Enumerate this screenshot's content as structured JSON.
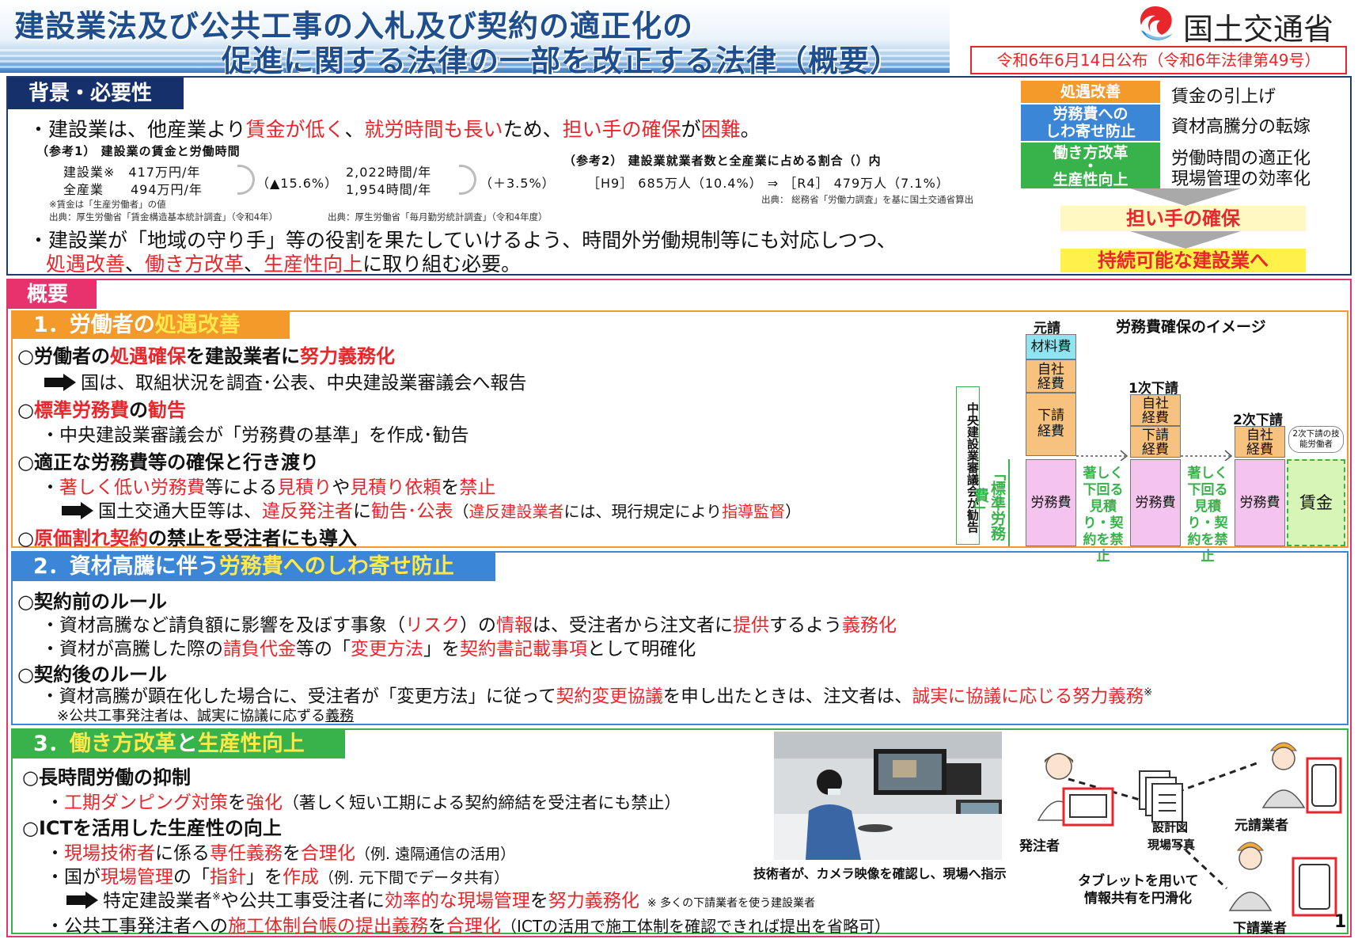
{
  "header": {
    "title_line1": "建設業法及び公共工事の入札及び契約の適正化の",
    "title_line2": "促進に関する法律の一部を改正する法律（概要）",
    "ministry": "国土交通省",
    "promulgation": "令和6年6月14日公布（令和6年法律第49号）"
  },
  "background": {
    "label": "背景・必要性",
    "bullet1": {
      "a": "・建設業は、他産業より",
      "b": "賃金が低く",
      "c": "、",
      "d": "就労時間も長い",
      "e": "ため、",
      "f": "担い手の確保",
      "g": "が",
      "h": "困難",
      "i": "。"
    },
    "ref1": {
      "title": "（参考1） 建設業の賃金と労働時間",
      "row1": "建設業※　417万円/年",
      "row2": "全産業　　494万円/年",
      "change1": "（▲15.6%）",
      "hours1": "2,022時間/年",
      "hours2": "1,954時間/年",
      "change2": "（＋3.5%）",
      "note": "※賃金は「生産労働者」の値",
      "source1": "出典：厚生労働省「賃金構造基本統計調査」（令和4年）",
      "source2": "出典：厚生労働省「毎月勤労統計調査」（令和4年度）"
    },
    "ref2": {
      "title": "（参考2） 建設業就業者数と全産業に占める割合（）内",
      "data": "［H9］ 685万人（10.4%） ⇒ ［R4］ 479万人（7.1%）",
      "source": "出典： 総務省「労働力調査」を基に国土交通省算出"
    },
    "bullet2": {
      "a": "・建設業が「地域の守り手」等の役割を果たしていけるよう、時間外労働規制等にも対応しつつ、",
      "b": "処遇改善",
      "c": "、",
      "d": "働き方改革",
      "e": "、",
      "f": "生産性向上",
      "g": "に取り組む必要。"
    },
    "summary": {
      "tag_treat": "処遇改善",
      "desc_treat": "賃金の引上げ",
      "tag_labor1": "労務費への",
      "tag_labor2": "しわ寄せ防止",
      "desc_labor": "資材高騰分の転嫁",
      "tag_work1": "働き方改革",
      "tag_work_dot": "・",
      "tag_work2": "生産性向上",
      "desc_work1": "労働時間の適正化",
      "desc_work2": "現場管理の効率化",
      "result1": "担い手の確保",
      "result2": "持続可能な建設業へ"
    }
  },
  "overview": {
    "label": "概要",
    "s1": {
      "label_num": "1．労働者の",
      "label_hl": "処遇改善",
      "h1": {
        "a": "○労働者の",
        "b": "処遇確保",
        "c": "を建設業者に",
        "d": "努力義務化"
      },
      "l1": "国は、取組状況を調査･公表、中央建設業審議会へ報告",
      "h2": {
        "a": "○",
        "b": "標準労務費",
        "c": "の",
        "d": "勧告"
      },
      "l2": "・中央建設業審議会が「労務費の基準」を作成･勧告",
      "h3": "○適正な労務費等の確保と行き渡り",
      "l3": {
        "a": "・",
        "b": "著しく低い労務費",
        "c": "等による",
        "d": "見積り",
        "e": "や",
        "f": "見積り依頼",
        "g": "を",
        "h": "禁止"
      },
      "l4": {
        "a": "国土交通大臣等は、",
        "b": "違反発注者",
        "c": "に",
        "d": "勧告･公表",
        "e": "（",
        "f": "違反建設業者",
        "g": "には、現行規定により",
        "h": "指導監督",
        "i": "）"
      },
      "h4": {
        "a": "○",
        "b": "原価割れ契約",
        "c": "の禁止を受注者にも導入"
      },
      "diagram": {
        "title": "労務費確保のイメージ",
        "prime": "元請",
        "sub1": "1次下請",
        "sub2": "2次下請",
        "material": "材料費",
        "own_cost": "自社経費",
        "sub_cost": "下請経費",
        "labor": "労務費",
        "wage": "賃金",
        "sub2_worker": "2次下請の技能労働者",
        "council": "中央建設業審議会が勧告",
        "standard": "「標準労務費」",
        "prohibit": "著しく下回る見積り・契約を禁止"
      }
    },
    "s2": {
      "label_num": "2．資材高騰に伴う",
      "label_hl": "労務費へのしわ寄せ防止",
      "h1": "○契約前のルール",
      "l1": {
        "a": "・資材高騰など請負額に影響を及ぼす事象（",
        "b": "リスク",
        "c": "）の",
        "d": "情報",
        "e": "は、受注者から注文者に",
        "f": "提供",
        "g": "するよう",
        "h": "義務化"
      },
      "l2": {
        "a": "・資材が高騰した際の",
        "b": "請負代金",
        "c": "等の「",
        "d": "変更方法",
        "e": "」を",
        "f": "契約書記載事項",
        "g": "として明確化"
      },
      "h2": "○契約後のルール",
      "l3": {
        "a": "・資材高騰が顕在化した場合に、受注者が「変更方法」に従って",
        "b": "契約変更協議",
        "c": "を申し出たときは、注文者は、",
        "d": "誠実に協議に応じる努力義務",
        "e": "※"
      },
      "note": {
        "a": "※公共工事発注者は、誠実に協議に応ずる",
        "b": "義務"
      }
    },
    "s3": {
      "label_num": "3．",
      "label_hl1": "働き方改革",
      "label_mid": "と",
      "label_hl2": "生産性向上",
      "h1": "○長時間労働の抑制",
      "l1": {
        "a": "・",
        "b": "工期ダンピング対策",
        "c": "を",
        "d": "強化",
        "e": "（著しく短い工期による契約締結を受注者にも禁止）"
      },
      "h2": "○ICTを活用した生産性の向上",
      "l2": {
        "a": "・",
        "b": "現場技術者",
        "c": "に係る",
        "d": "専任義務",
        "e": "を",
        "f": "合理化",
        "g": "（例. 遠隔通信の活用）"
      },
      "l3": {
        "a": "・国が",
        "b": "現場管理",
        "c": "の「",
        "d": "指針",
        "e": "」を",
        "f": "作成",
        "g": "（例. 元下間でデータ共有）"
      },
      "l4": {
        "a": "特定建設業者",
        "b": "※",
        "c": "や公共工事受注者に",
        "d": "効率的な現場管理",
        "e": "を",
        "f": "努力義務化",
        "g": "※ 多くの下請業者を使う建設業者"
      },
      "l5": {
        "a": "・公共工事発注者への",
        "b": "施工体制台帳の提出義務",
        "c": "を",
        "d": "合理化",
        "e": "（ICTの活用で施工体制を確認できれば提出を省略可）"
      },
      "photo_caption": "技術者が、カメラ映像を確認し、現場へ指示",
      "orderer": "発注者",
      "docs1": "設計図",
      "docs2": "現場写真",
      "prime_contractor": "元請業者",
      "sub_contractor": "下請業者",
      "tablet1": "タブレットを用いて",
      "tablet2": "情報共有を円滑化"
    }
  },
  "page_number": "1",
  "colors": {
    "title_blue": "#1f4e8f",
    "navy": "#16306b",
    "pink": "#e8326e",
    "orange": "#f39a2b",
    "blue": "#3b86d6",
    "green": "#38b24a",
    "red": "#e8262b"
  }
}
